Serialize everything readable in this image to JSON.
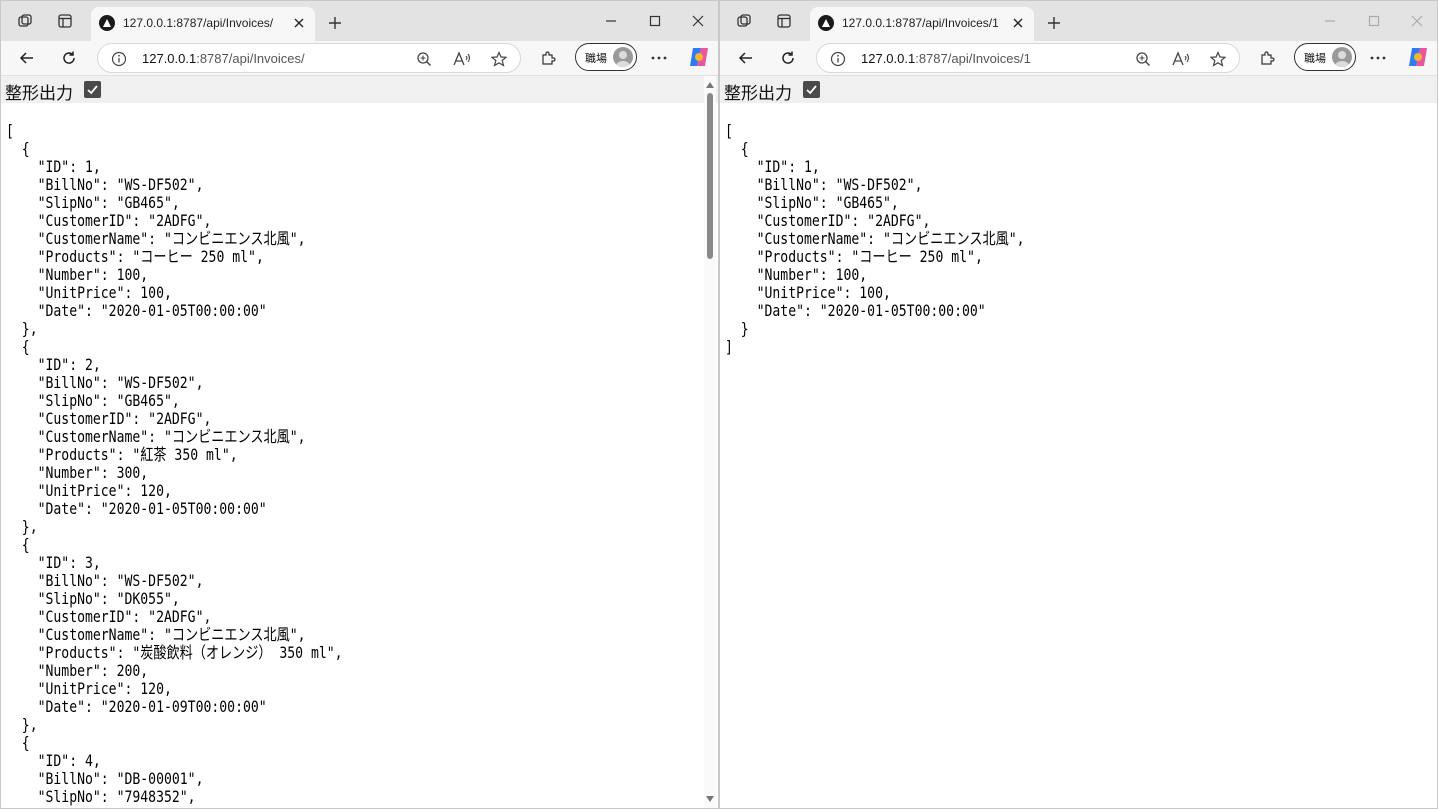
{
  "windows": {
    "left": {
      "tab_title": "127.0.0.1:8787/api/Invoices/",
      "address_host": "127.0.0.1",
      "address_rest": ":8787/api/Invoices/",
      "profile_name": "職場",
      "pretty_label": "整形出力",
      "json_text": "[\n  {\n    \"ID\": 1,\n    \"BillNo\": \"WS-DF502\",\n    \"SlipNo\": \"GB465\",\n    \"CustomerID\": \"2ADFG\",\n    \"CustomerName\": \"コンビニエンス北風\",\n    \"Products\": \"コーヒー 250 ml\",\n    \"Number\": 100,\n    \"UnitPrice\": 100,\n    \"Date\": \"2020-01-05T00:00:00\"\n  },\n  {\n    \"ID\": 2,\n    \"BillNo\": \"WS-DF502\",\n    \"SlipNo\": \"GB465\",\n    \"CustomerID\": \"2ADFG\",\n    \"CustomerName\": \"コンビニエンス北風\",\n    \"Products\": \"紅茶 350 ml\",\n    \"Number\": 300,\n    \"UnitPrice\": 120,\n    \"Date\": \"2020-01-05T00:00:00\"\n  },\n  {\n    \"ID\": 3,\n    \"BillNo\": \"WS-DF502\",\n    \"SlipNo\": \"DK055\",\n    \"CustomerID\": \"2ADFG\",\n    \"CustomerName\": \"コンビニエンス北風\",\n    \"Products\": \"炭酸飲料（オレンジ） 350 ml\",\n    \"Number\": 200,\n    \"UnitPrice\": 120,\n    \"Date\": \"2020-01-09T00:00:00\"\n  },\n  {\n    \"ID\": 4,\n    \"BillNo\": \"DB-00001\",\n    \"SlipNo\": \"7948352\","
    },
    "right": {
      "tab_title": "127.0.0.1:8787/api/Invoices/1",
      "address_host": "127.0.0.1",
      "address_rest": ":8787/api/Invoices/1",
      "profile_name": "職場",
      "pretty_label": "整形出力",
      "json_text": "[\n  {\n    \"ID\": 1,\n    \"BillNo\": \"WS-DF502\",\n    \"SlipNo\": \"GB465\",\n    \"CustomerID\": \"2ADFG\",\n    \"CustomerName\": \"コンビニエンス北風\",\n    \"Products\": \"コーヒー 250 ml\",\n    \"Number\": 100,\n    \"UnitPrice\": 100,\n    \"Date\": \"2020-01-05T00:00:00\"\n  }\n]"
    }
  },
  "icons": [
    "workspaces-icon",
    "tab-actions-icon",
    "favicon-icon",
    "close-icon",
    "new-tab-icon",
    "minimize-icon",
    "maximize-icon",
    "back-icon",
    "refresh-icon",
    "info-icon",
    "zoom-icon",
    "read-aloud-icon",
    "favorite-star-icon",
    "extensions-icon",
    "more-icon",
    "copilot-icon",
    "checkbox-check-icon"
  ],
  "colors": {
    "tabbar": "#e3e3e3",
    "toolbar": "#f7f7f7",
    "pretty_bar": "#f0f0f0"
  },
  "pretty_checked": true
}
